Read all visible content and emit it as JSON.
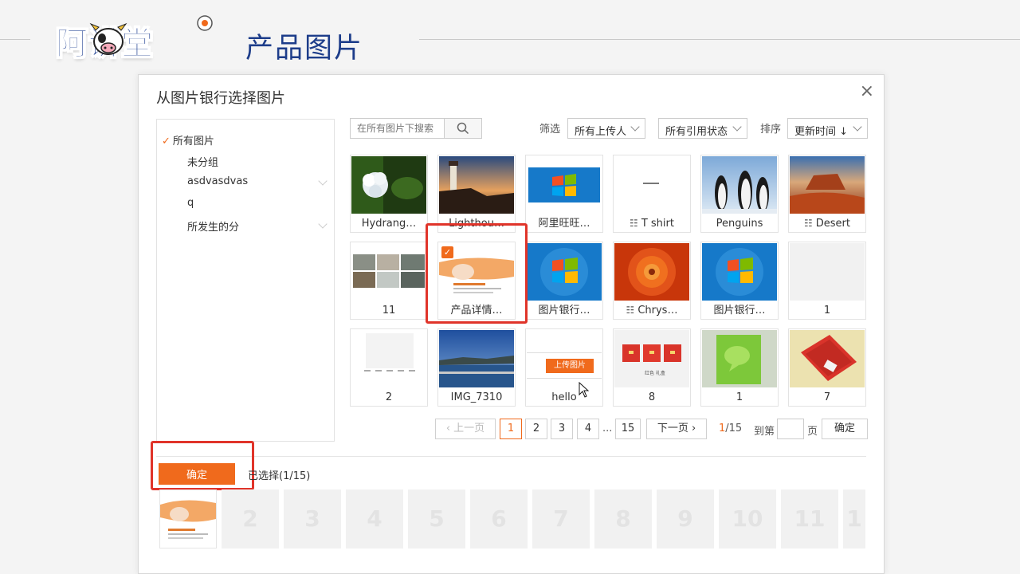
{
  "header": {
    "logo_text": "阿讲堂",
    "title": "产品图片"
  },
  "dialog": {
    "title": "从图片银行选择图片",
    "close_label": "×",
    "sidebar": {
      "items": [
        {
          "label": "所有图片",
          "active": true
        },
        {
          "label": "未分组"
        },
        {
          "label": "asdvasdvas",
          "has_children": true
        },
        {
          "label": "q"
        },
        {
          "label": "所发生的分",
          "has_children": true
        }
      ]
    },
    "search": {
      "placeholder": "在所有图片下搜索"
    },
    "filters": {
      "filter_label": "筛选",
      "uploader": "所有上传人",
      "ref_status": "所有引用状态",
      "sort_label": "排序",
      "sort_value": "更新时间 ↓"
    },
    "images": [
      {
        "label": "Hydrang…",
        "icon": "hydrangea-photo"
      },
      {
        "label": "Lighthou…",
        "icon": "lighthouse-photo"
      },
      {
        "label": "阿里旺旺…",
        "icon": "windows-logo"
      },
      {
        "label": "T shirt",
        "icon": "list-icon"
      },
      {
        "label": "Penguins",
        "icon": "penguins-photo"
      },
      {
        "label": "Desert",
        "icon": "list-icon"
      },
      {
        "label": "11",
        "icon": "collage-photo"
      },
      {
        "label": "产品详情…",
        "icon": "product-detail",
        "selected": true
      },
      {
        "label": "图片银行…",
        "icon": "windows-logo"
      },
      {
        "label": "Chrys…",
        "icon": "list-icon"
      },
      {
        "label": "图片银行…",
        "icon": "windows-logo"
      },
      {
        "label": "1",
        "icon": "blank"
      },
      {
        "label": "2",
        "icon": "blank-doc"
      },
      {
        "label": "IMG_7310",
        "icon": "sea-photo"
      },
      {
        "label": "hello",
        "icon": "upload-button-shot",
        "upload_text": "上传图片"
      },
      {
        "label": "8",
        "icon": "red-boxes-photo",
        "caption": "红色 礼盒"
      },
      {
        "label": "1",
        "icon": "green-bag-photo"
      },
      {
        "label": "7",
        "icon": "red-pouch-photo"
      }
    ],
    "pagination": {
      "prev": "上一页",
      "pages": [
        "1",
        "2",
        "3",
        "4"
      ],
      "ellipsis": "...",
      "last": "15",
      "next": "下一页",
      "current": "1",
      "total": "/15",
      "goto_label": "到第",
      "page_unit": "页",
      "confirm": "确定"
    },
    "footer": {
      "confirm": "确定",
      "selected_text": "已选择(1/15)",
      "slots": [
        "2",
        "3",
        "4",
        "5",
        "6",
        "7",
        "8",
        "9",
        "10",
        "11",
        "1"
      ]
    }
  },
  "colors": {
    "accent": "#f06a1c",
    "highlight": "#e0342a",
    "title_blue": "#1d3d8a"
  }
}
